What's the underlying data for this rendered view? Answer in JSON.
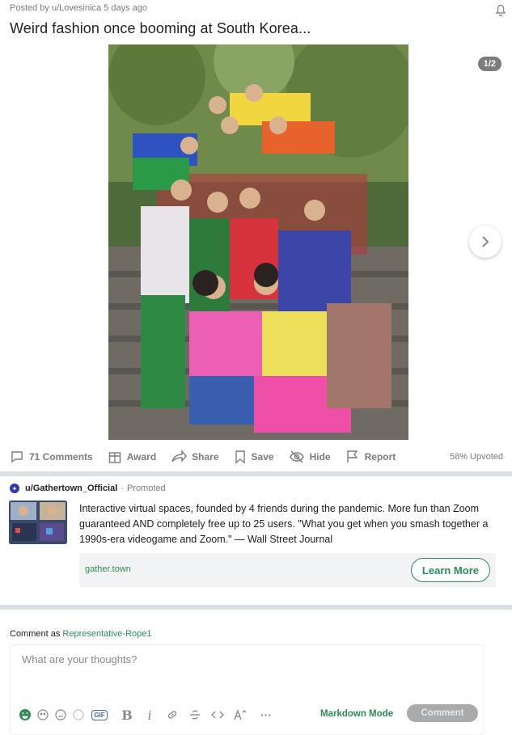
{
  "post": {
    "meta": "Posted by u/Lovesinica 5 days ago",
    "title": "Weird fashion once booming at South Korea...",
    "gallery_counter": "1/2"
  },
  "icons": {
    "bell": "bell-icon",
    "next": "chevron-right-icon",
    "comments": "comment-bubble-icon",
    "award": "award-icon",
    "share": "share-arrow-icon",
    "save": "bookmark-icon",
    "hide": "eye-slash-icon",
    "report": "flag-icon"
  },
  "actions": {
    "comments": "71 Comments",
    "award": "Award",
    "share": "Share",
    "save": "Save",
    "hide": "Hide",
    "report": "Report",
    "upvoted": "58% Upvoted"
  },
  "promo": {
    "user": "u/Gathertown_Official",
    "dot": "·",
    "tag": "Promoted",
    "text": "Interactive virtual spaces, founded by 4 friends during the pandemic. More fun than Zoom guaranteed AND completely free up to 25 users. \"What you get when you smash together a 1990s-era videogame and Zoom.\" — Wall Street Journal",
    "domain": "gather.town",
    "cta": "Learn More"
  },
  "comment": {
    "as_label": "Comment as",
    "user": "Representative-Rope1",
    "placeholder": "What are your thoughts?",
    "markdown_mode": "Markdown Mode",
    "submit": "Comment",
    "toolbar": {
      "gif": "GIF",
      "bold": "B",
      "italic": "i",
      "more": "···"
    }
  },
  "colors": {
    "accent_green": "#2e8b57",
    "separator": "#dae0e6",
    "meta_gray": "#7c7c7c"
  }
}
